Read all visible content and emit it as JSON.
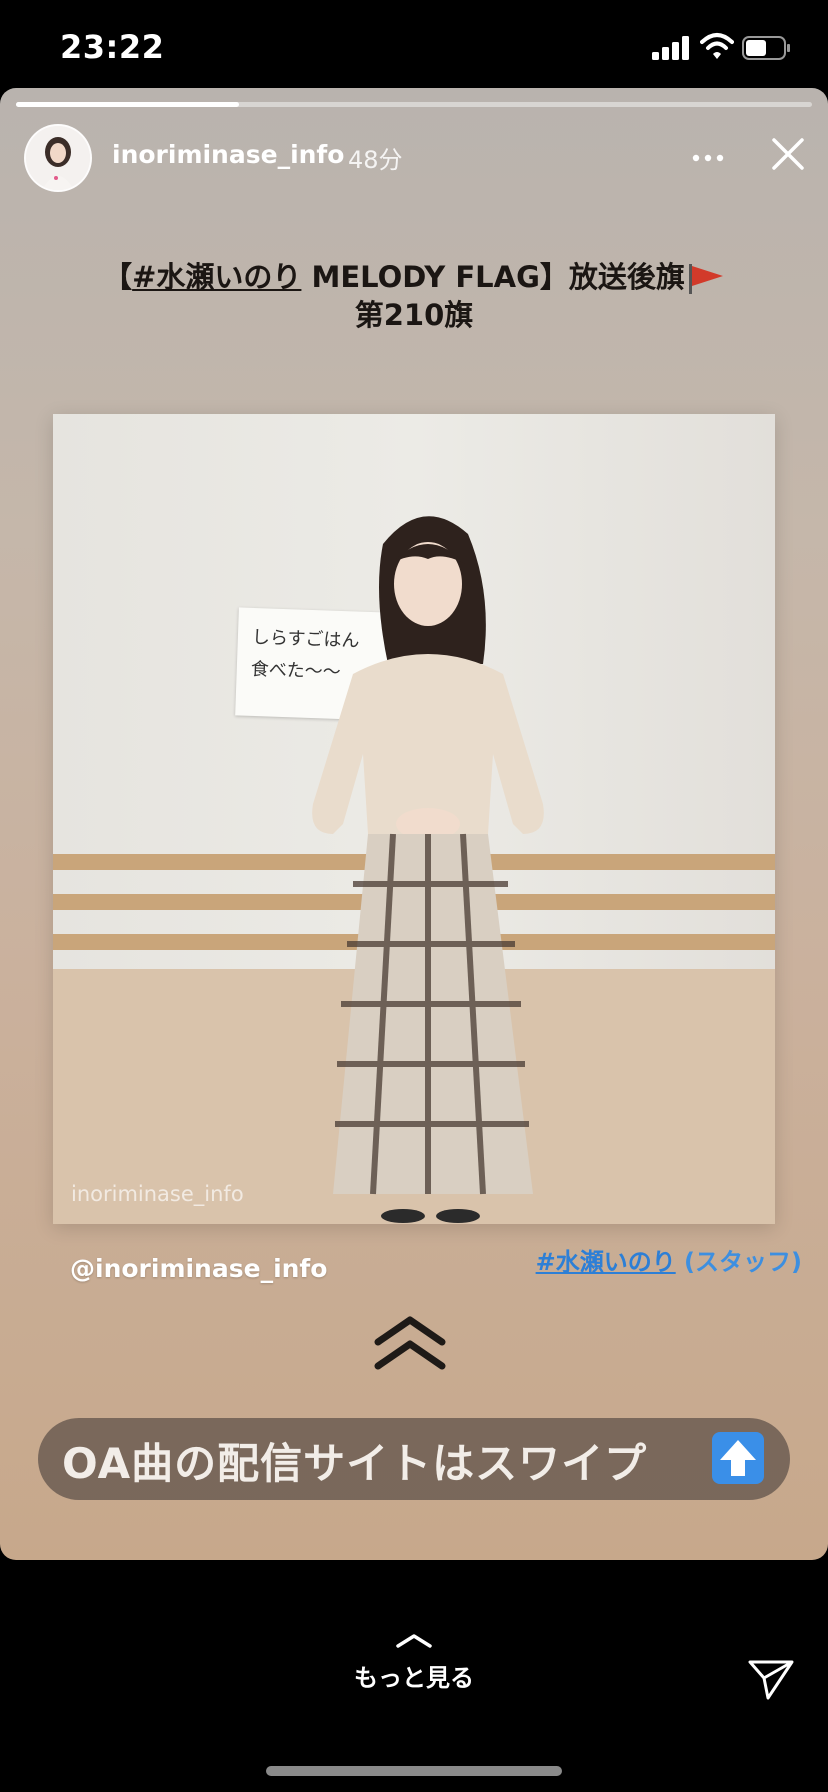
{
  "status_bar": {
    "time": "23:22"
  },
  "story": {
    "progress": 0.28,
    "username": "inoriminase_info",
    "time_ago": "48分",
    "headline": {
      "open": "【",
      "tag": "#水瀬いのり",
      "rest": " MELODY FLAG】放送後旗",
      "line2": "第210旗"
    },
    "note_text_line1": "しらすごはん",
    "note_text_line2": "食べた〜〜",
    "photo_watermark": "inoriminase_info",
    "mention": "@inoriminase_info",
    "hashtag": "#水瀬いのり",
    "hashtag_suffix": " (スタッフ)",
    "swipe_text": "OA曲の配信サイトはスワイプ"
  },
  "bottom": {
    "see_more": "もっと見る"
  },
  "colors": {
    "hashtag": "#3d8fe0",
    "swipe_pill": "#6e5f54",
    "flag": "#d23a2a"
  },
  "icons": [
    "signal-icon",
    "wifi-icon",
    "battery-icon",
    "more-icon",
    "close-icon",
    "flag-icon",
    "swipe-chevron-icon",
    "up-arrow-icon",
    "send-icon"
  ]
}
